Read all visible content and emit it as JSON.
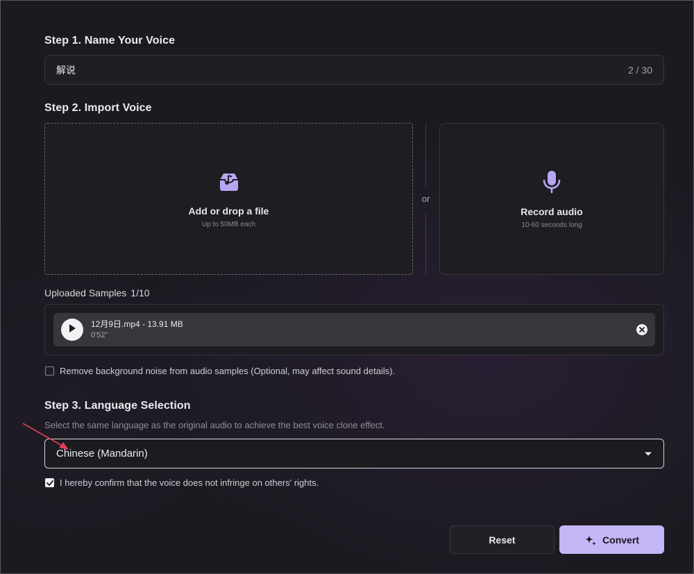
{
  "step1": {
    "title": "Step 1. Name Your Voice",
    "name_value": "解说",
    "char_count": "2 / 30"
  },
  "step2": {
    "title": "Step 2. Import Voice",
    "upload": {
      "icon": "tray-music-icon",
      "title": "Add or drop a file",
      "subtitle": "Up to 50MB each"
    },
    "or_label": "or",
    "record": {
      "icon": "microphone-icon",
      "title": "Record audio",
      "subtitle": "10-60 seconds long"
    }
  },
  "samples": {
    "label": "Uploaded Samples",
    "count": "1/10",
    "items": [
      {
        "name": "12月9日.mp4 - 13.91 MB",
        "duration": "0'52\""
      }
    ]
  },
  "noise": {
    "label": "Remove background noise from audio samples (Optional, may affect sound details).",
    "checked": false
  },
  "step3": {
    "title": "Step 3. Language Selection",
    "subtitle": "Select the same language as the original audio to achieve the best voice clone effect.",
    "selected_language": "Chinese (Mandarin)"
  },
  "confirm": {
    "label": "I hereby confirm that the voice does not infringe on others' rights.",
    "checked": true
  },
  "actions": {
    "reset_label": "Reset",
    "convert_label": "Convert"
  },
  "colors": {
    "accent": "#c5b6f7",
    "icon_purple": "#b9a6f2",
    "annotation_arrow": "#e0405a"
  }
}
